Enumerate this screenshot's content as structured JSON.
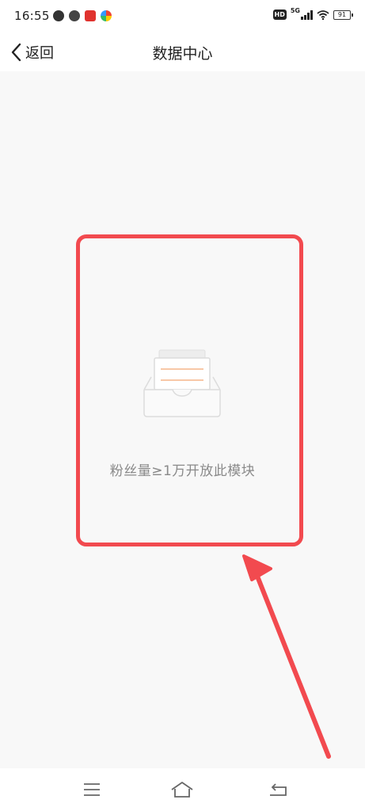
{
  "status_bar": {
    "time": "16:55",
    "app_icons": [
      "weibo-icon",
      "target-icon",
      "red-app-icon",
      "color-app-icon"
    ],
    "hd": "HD",
    "network": "5G",
    "battery": "91"
  },
  "nav": {
    "back_label": "返回",
    "title": "数据中心"
  },
  "empty_state": {
    "message": "粉丝量≥1万开放此模块",
    "icon": "empty-inbox-icon"
  },
  "annotation": {
    "highlight_color": "#f24a4f",
    "arrow_color": "#f24a4f"
  },
  "system_nav": {
    "buttons": [
      "menu-icon",
      "home-icon",
      "back-icon"
    ]
  },
  "colors": {
    "accent_line": "#f5b58a",
    "background": "#f8f8f8",
    "text_muted": "#8a8a8a"
  }
}
